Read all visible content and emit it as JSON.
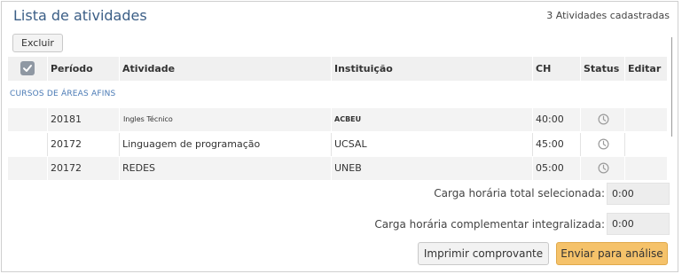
{
  "header": {
    "title": "Lista de atividades",
    "count_label": "3 Atividades cadastradas"
  },
  "toolbar": {
    "delete_label": "Excluir"
  },
  "table": {
    "columns": [
      "Período",
      "Atividade",
      "Instituição",
      "CH",
      "Status",
      "Editar"
    ],
    "select_all_icon": "checkbox-check-icon",
    "group_label": "CURSOS DE ÁREAS AFINS",
    "rows": [
      {
        "periodo": "20181",
        "atividade": "Ingles Técnico",
        "instituicao": "ACBEU",
        "ch": "40:00",
        "status_icon": "clock-icon"
      },
      {
        "periodo": "20172",
        "atividade": "Linguagem de programação",
        "instituicao": "UCSAL",
        "ch": "45:00",
        "status_icon": "clock-icon"
      },
      {
        "periodo": "20172",
        "atividade": "REDES",
        "instituicao": "UNEB",
        "ch": "05:00",
        "status_icon": "clock-icon"
      }
    ]
  },
  "summary": {
    "total_selected_label": "Carga horária total selecionada:",
    "total_selected_value": "0:00",
    "complementary_label": "Carga horária complementar integralizada:",
    "complementary_value": "0:00"
  },
  "actions": {
    "print_label": "Imprimir comprovante",
    "send_label": "Enviar para análise"
  },
  "colors": {
    "title": "#3b5e86",
    "group_label": "#4a7ab5",
    "send_button": "#f5c26a"
  }
}
